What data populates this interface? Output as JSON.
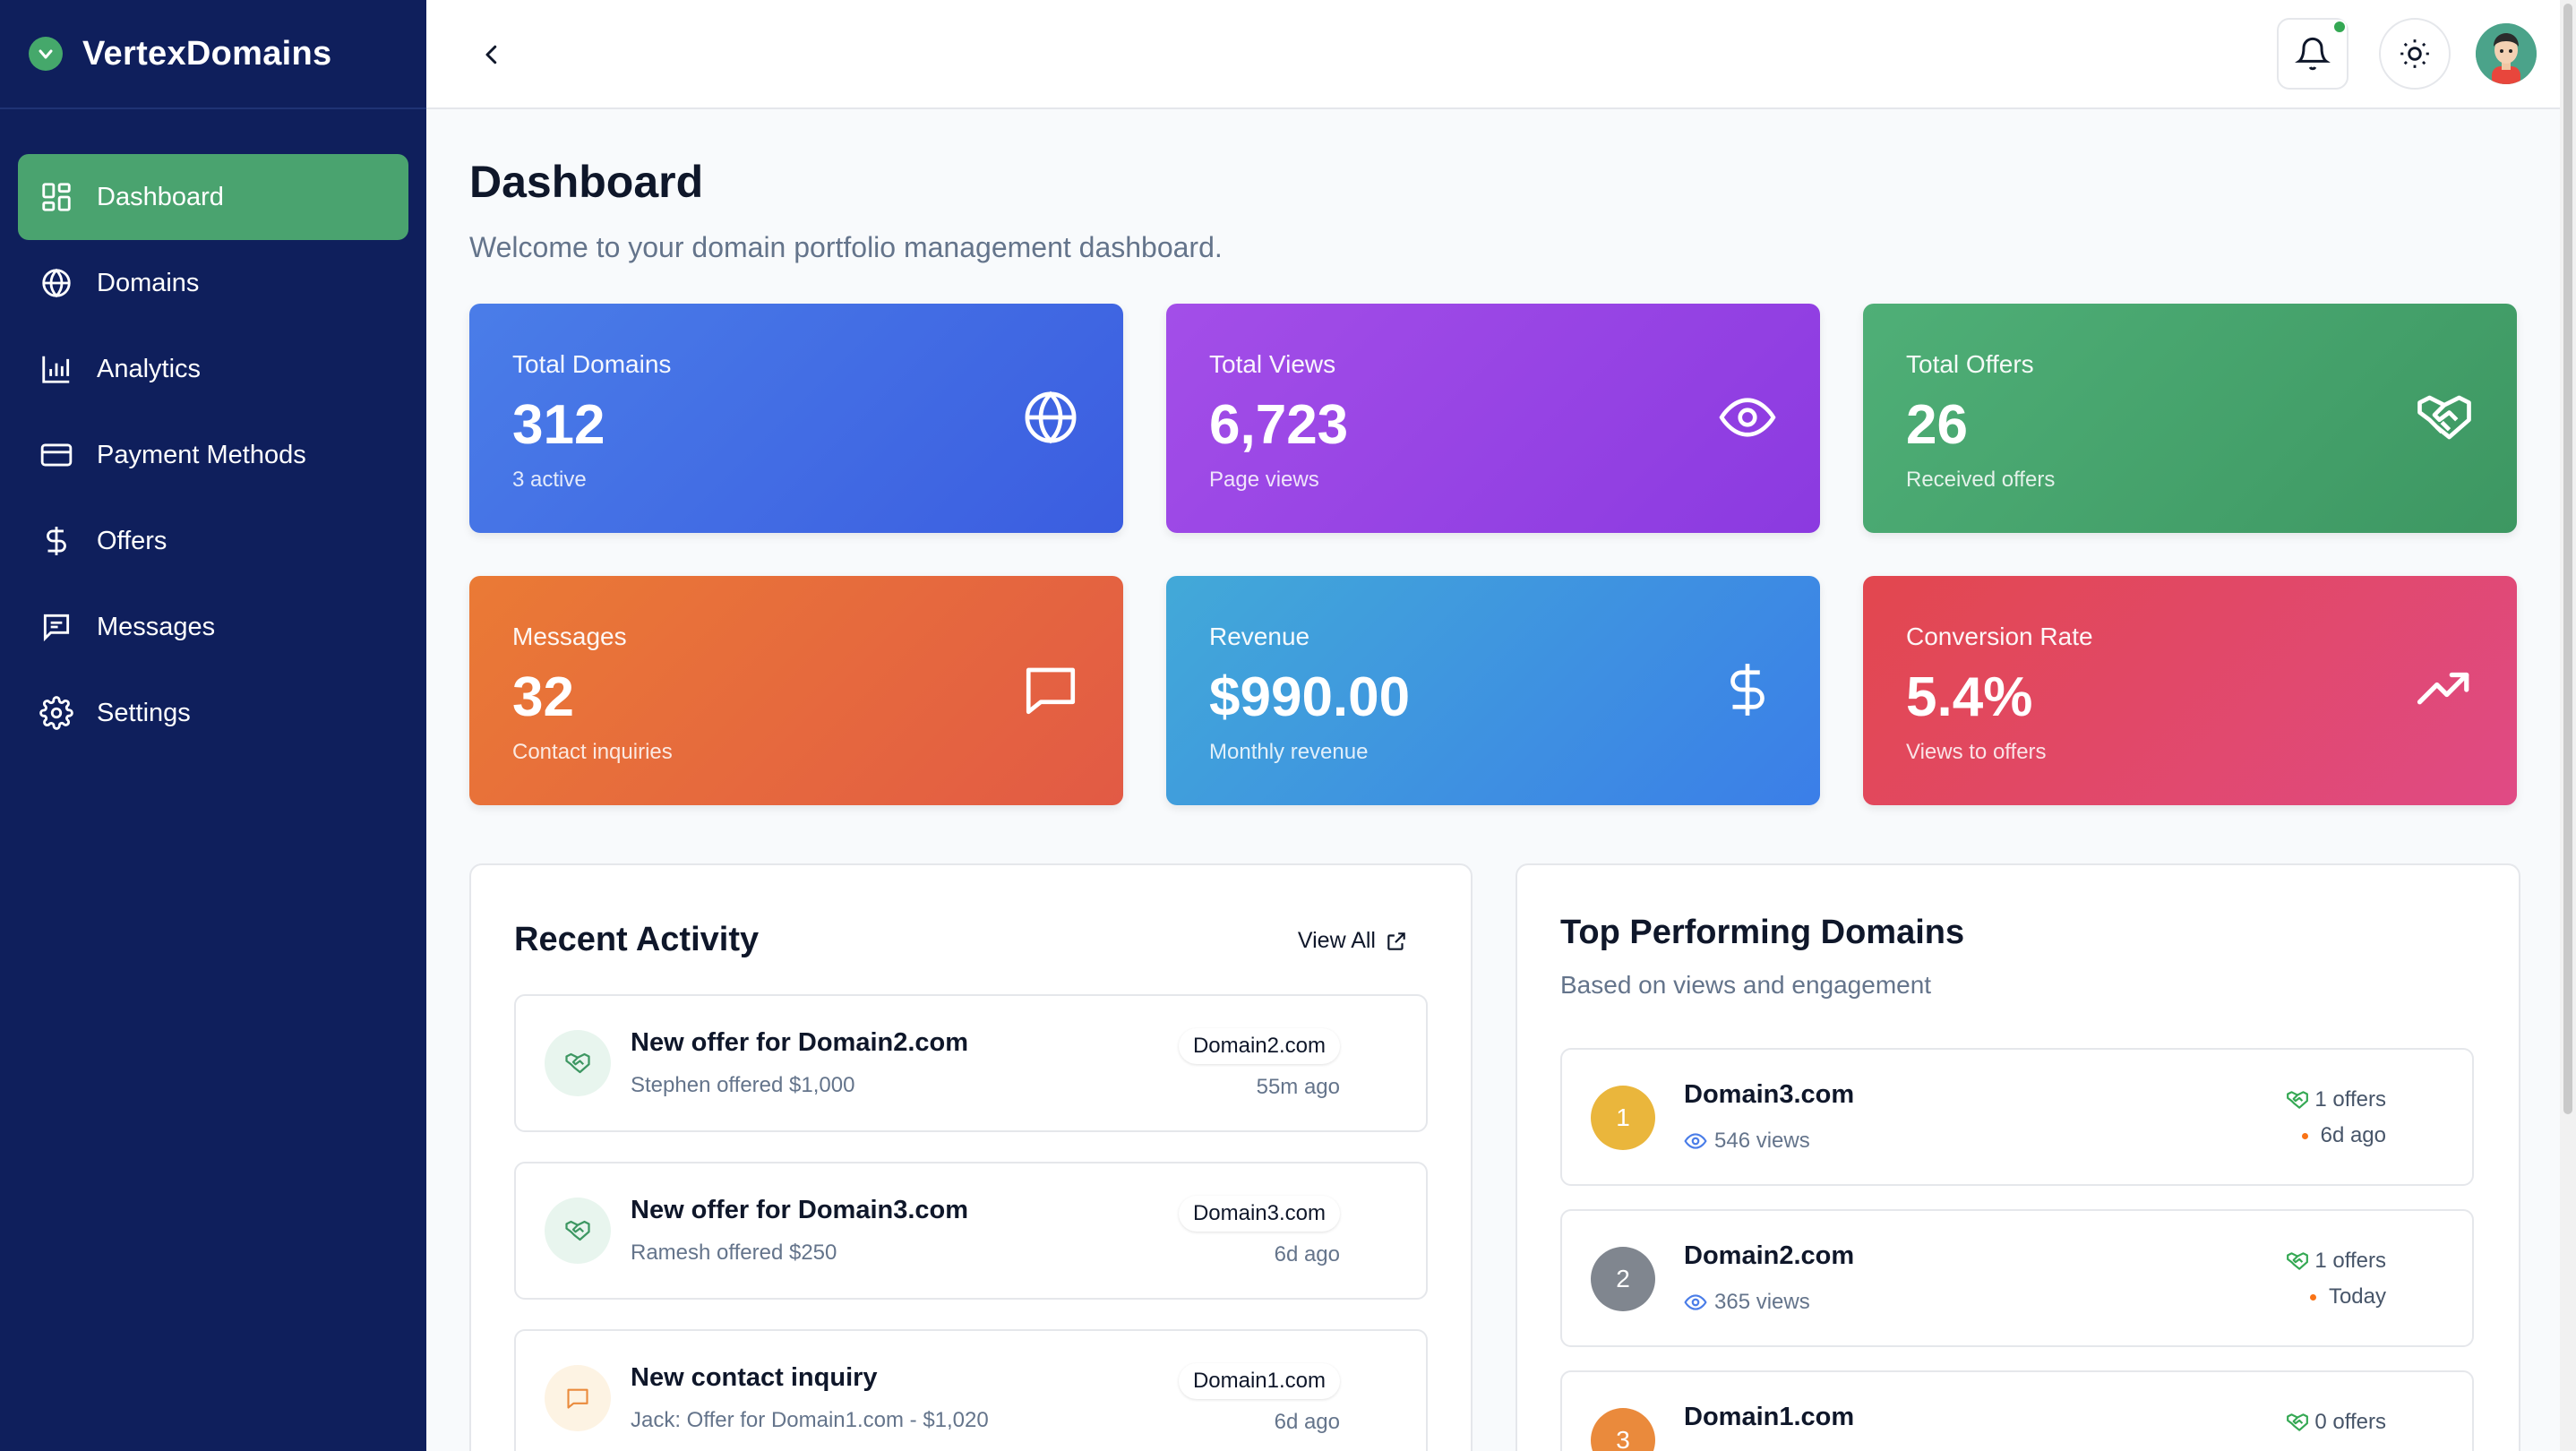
{
  "brand": {
    "name": "VertexDomains"
  },
  "sidebar": {
    "items": [
      {
        "label": "Dashboard",
        "icon": "dashboard-grid-icon",
        "active": true
      },
      {
        "label": "Domains",
        "icon": "globe-icon"
      },
      {
        "label": "Analytics",
        "icon": "bar-chart-icon"
      },
      {
        "label": "Payment Methods",
        "icon": "credit-card-icon"
      },
      {
        "label": "Offers",
        "icon": "dollar-icon"
      },
      {
        "label": "Messages",
        "icon": "message-icon"
      },
      {
        "label": "Settings",
        "icon": "gear-icon"
      }
    ]
  },
  "header": {
    "title": "Dashboard",
    "subtitle": "Welcome to your domain portfolio management dashboard."
  },
  "stats": [
    {
      "label": "Total Domains",
      "value": "312",
      "sub": "3 active",
      "icon": "globe-icon"
    },
    {
      "label": "Total Views",
      "value": "6,723",
      "sub": "Page views",
      "icon": "eye-icon"
    },
    {
      "label": "Total Offers",
      "value": "26",
      "sub": "Received offers",
      "icon": "handshake-icon"
    },
    {
      "label": "Messages",
      "value": "32",
      "sub": "Contact inquiries",
      "icon": "chat-icon"
    },
    {
      "label": "Revenue",
      "value": "$990.00",
      "sub": "Monthly revenue",
      "icon": "dollar-icon"
    },
    {
      "label": "Conversion Rate",
      "value": "5.4%",
      "sub": "Views to offers",
      "icon": "trending-up-icon"
    }
  ],
  "recent_activity": {
    "title": "Recent Activity",
    "view_all": "View All",
    "items": [
      {
        "title": "New offer for Domain2.com",
        "desc": "Stephen offered $1,000",
        "badge": "Domain2.com",
        "time": "55m ago",
        "icon": "handshake-icon"
      },
      {
        "title": "New offer for Domain3.com",
        "desc": "Ramesh offered $250",
        "badge": "Domain3.com",
        "time": "6d ago",
        "icon": "handshake-icon"
      },
      {
        "title": "New contact inquiry",
        "desc": "Jack: Offer for Domain1.com - $1,020",
        "badge": "Domain1.com",
        "time": "6d ago",
        "icon": "chat-icon"
      }
    ]
  },
  "top_domains": {
    "title": "Top Performing Domains",
    "subtitle": "Based on views and engagement",
    "items": [
      {
        "rank": "1",
        "name": "Domain3.com",
        "views": "546 views",
        "offers": "1 offers",
        "time": "6d ago",
        "color": "#eab63c"
      },
      {
        "rank": "2",
        "name": "Domain2.com",
        "views": "365 views",
        "offers": "1 offers",
        "time": "Today",
        "color": "#80868f"
      },
      {
        "rank": "3",
        "name": "Domain1.com",
        "views": "",
        "offers": "0 offers",
        "time": "",
        "color": "#ea8a3c"
      }
    ]
  },
  "colors": {
    "sidebar": "#0f1f5c",
    "active": "#4aa36f",
    "accent_green": "#34a853"
  }
}
